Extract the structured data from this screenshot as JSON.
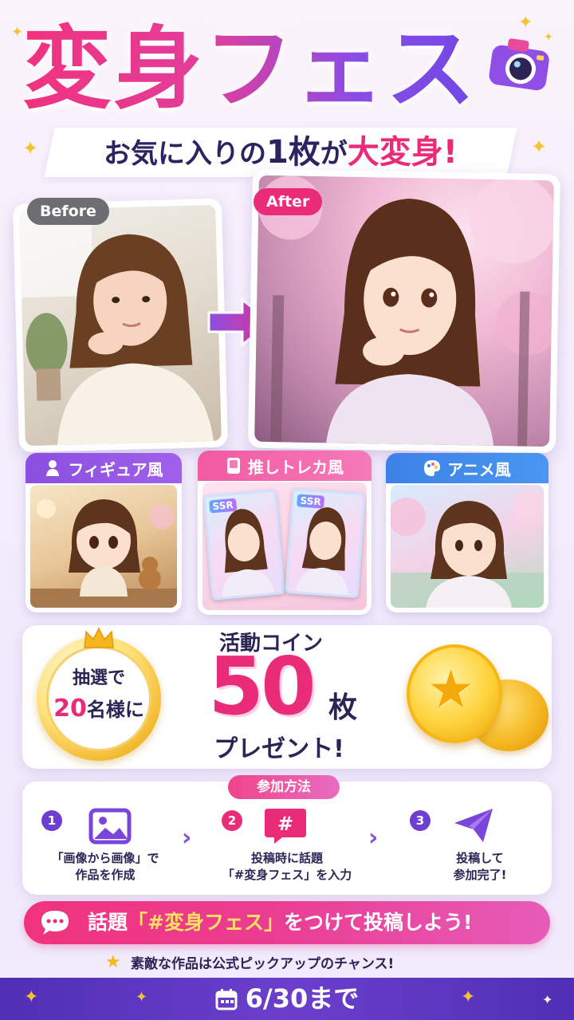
{
  "header": {
    "title": "変身フェス",
    "subtitle_pre": "お気に入りの",
    "subtitle_num": "1枚",
    "subtitle_mid": "が",
    "subtitle_hl": "大変身",
    "subtitle_end": "!"
  },
  "comparison": {
    "before_label": "Before",
    "after_label": "After"
  },
  "styles": [
    {
      "label": "フィギュア風",
      "icon": "figure-icon"
    },
    {
      "label": "推しトレカ風",
      "icon": "card-icon"
    },
    {
      "label": "アニメ風",
      "icon": "palette-icon"
    }
  ],
  "trading_card_badge": "SSR",
  "prize": {
    "medal_line1": "抽選で",
    "medal_num": "20",
    "medal_line2": "名様に",
    "coin_label": "活動コイン",
    "amount": "50",
    "unit": "枚",
    "present": "プレゼント!"
  },
  "join": {
    "title": "参加方法",
    "steps": [
      {
        "num": "1",
        "line1": "「画像から画像」で",
        "line2": "作品を作成",
        "icon": "image-icon"
      },
      {
        "num": "2",
        "line1": "投稿時に話題",
        "line2": "「#変身フェス」を入力",
        "icon": "hashtag-icon"
      },
      {
        "num": "3",
        "line1": "投稿して",
        "line2": "参加完了!",
        "icon": "send-icon"
      }
    ]
  },
  "banner": {
    "pre": "話題",
    "tag": "「#変身フェス」",
    "post": "をつけて投稿しよう!"
  },
  "note": "素敵な作品は公式ピックアップのチャンス!",
  "deadline": "6/30まで",
  "colors": {
    "pink": "#ea2c78",
    "purple": "#8a4fe0",
    "blue": "#3b82e6",
    "navy": "#2d2455",
    "gold": "#f5c330",
    "footer": "#5a35c0"
  }
}
